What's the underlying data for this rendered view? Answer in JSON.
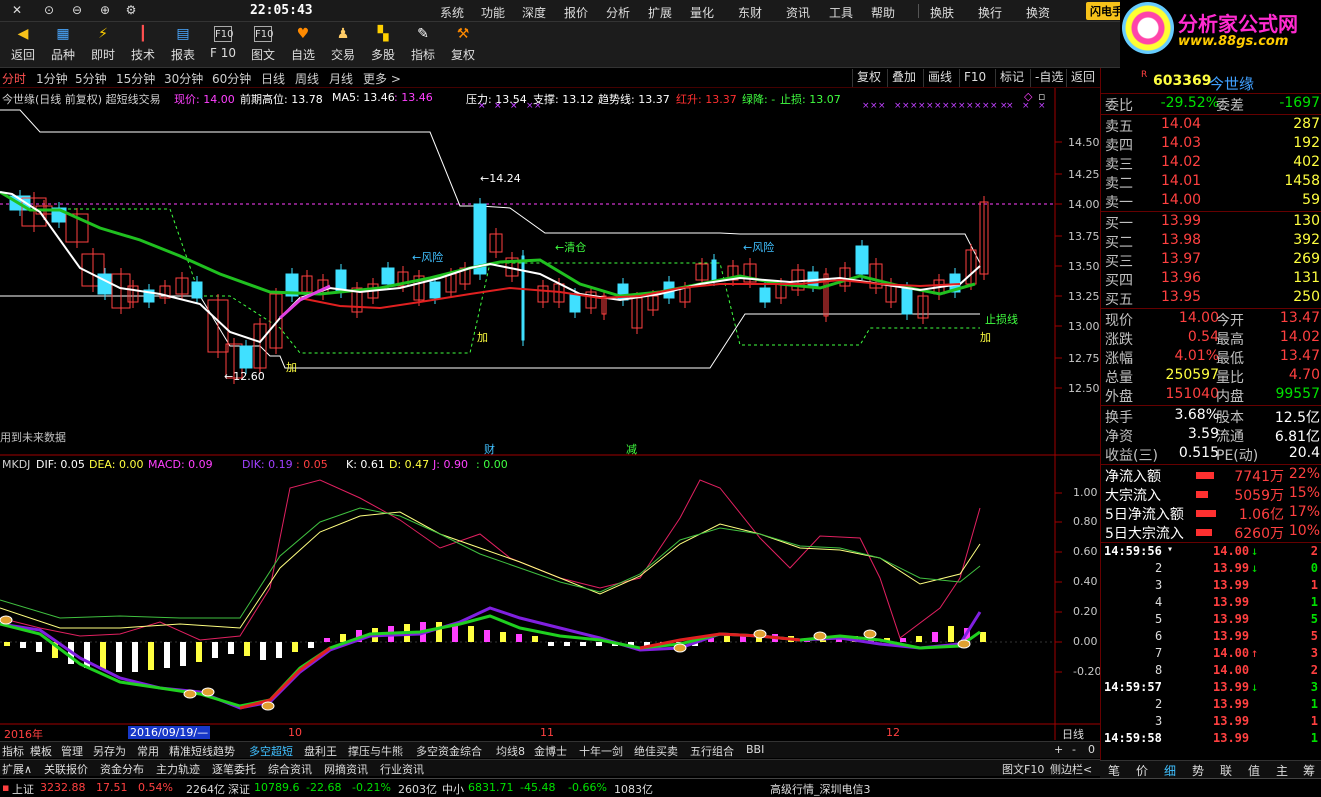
{
  "menubar": {
    "clock": "22:05:43",
    "items": [
      "系统",
      "功能",
      "深度",
      "报价",
      "分析",
      "扩展",
      "量化",
      "东财",
      "资讯",
      "工具",
      "帮助"
    ],
    "right_items": [
      "换肤",
      "换行",
      "换资"
    ],
    "flash_label": "闪电手",
    "logo_title": "分析家公式网",
    "logo_url": "www.88gs.com"
  },
  "toolbar": [
    {
      "label": "返回",
      "icon": "back-arrow-icon",
      "color": "#f7c21a"
    },
    {
      "label": "品种",
      "icon": "variety-icon",
      "color": "#4aa8ff"
    },
    {
      "label": "即时",
      "icon": "lightning-icon",
      "color": "#ffd000"
    },
    {
      "label": "技术",
      "icon": "candlestick-icon",
      "color": "#ff5050"
    },
    {
      "label": "报表",
      "icon": "report-icon",
      "color": "#4aa8ff"
    },
    {
      "label": "F 10",
      "icon": "f10-icon",
      "color": "#ddd"
    },
    {
      "label": "图文",
      "icon": "f10-doc-icon",
      "color": "#ddd"
    },
    {
      "label": "自选",
      "icon": "favorite-icon",
      "color": "#ff8a00"
    },
    {
      "label": "交易",
      "icon": "trade-person-icon",
      "color": "#ffcc66"
    },
    {
      "label": "多股",
      "icon": "multi-stock-icon",
      "color": "#ffd000"
    },
    {
      "label": "指标",
      "icon": "indicator-icon",
      "color": "#ffffff"
    },
    {
      "label": "复权",
      "icon": "hammer-icon",
      "color": "#ff8a00"
    }
  ],
  "periods": [
    "分时",
    "1分钟",
    "5分钟",
    "15分钟",
    "30分钟",
    "60分钟",
    "日线",
    "周线",
    "月线",
    "更多 >"
  ],
  "active_period": "分时",
  "chart_buttons": [
    "复权",
    "叠加",
    "画线",
    "F10",
    "标记",
    "-自选",
    "返回"
  ],
  "main_indicator": {
    "name": "今世缘(日线 前复权) 超短线交易",
    "price_label": "现价: 14.00",
    "prev_high": "前期高位: 13.78",
    "ma5": "MA5: 13.46",
    "ma5b": ": 13.46",
    "pressure": "压力: 13.54",
    "support": "支撑: 13.12",
    "trend": "趋势线: 13.37",
    "rise": "红升: 13.37",
    "fall": "绿降: -",
    "stop": "止损: 13.07"
  },
  "chart_annotations": {
    "high_label": "14.24",
    "low_label": "12.60",
    "risk1": "←风险",
    "clear": "←清仓",
    "risk2": "←风险",
    "stop_line": "止损线",
    "add1": "加",
    "add2": "加",
    "add3": "加",
    "future_note": "用到未来数据",
    "cai": "财",
    "jian": "减"
  },
  "price_axis": [
    "14.50",
    "14.25",
    "14.00",
    "13.75",
    "13.50",
    "13.25",
    "13.00",
    "12.75",
    "12.50"
  ],
  "macd_indicator": {
    "name": "MKDJ",
    "dif": "DIF: 0.05",
    "dea": "DEA: 0.00",
    "macd": "MACD: 0.09",
    "dik": "DIK: 0.19",
    "dik2": ": 0.05",
    "k": "K: 0.61",
    "d": "D: 0.47",
    "j": "J: 0.90",
    "j2": ": 0.00"
  },
  "macd_axis": [
    "1.00",
    "0.80",
    "0.60",
    "0.40",
    "0.20",
    "0.00",
    "-0.20"
  ],
  "date_axis": {
    "year": "2016年",
    "cursor_date": "2016/09/19/—",
    "m10": "10",
    "m11": "11",
    "m12": "12",
    "period": "日线"
  },
  "tabs_row1": [
    "指标",
    "模板",
    "管理",
    "另存为",
    "常用",
    "精准短线趋势",
    "多空超短",
    "盘利王",
    "撑压与牛熊",
    "多空资金综合",
    "均线8",
    "金博士",
    "十年一剑",
    "绝佳买卖",
    "五行组合",
    "BBI"
  ],
  "tabs_row1_active": "多空超短",
  "tabs_row2": [
    "扩展∧",
    "关联报价",
    "资金分布",
    "主力轨迹",
    "逐笔委托",
    "综合资讯",
    "网摘资讯",
    "行业资讯"
  ],
  "tabs_row2_right": [
    "图文F10",
    "侧边栏<"
  ],
  "stock": {
    "code": "603369",
    "name": "今世缘",
    "badge": "R"
  },
  "order_ratio": {
    "wb_label": "委比",
    "wb": "-29.52%",
    "wc_label": "委差",
    "wc": "-1697"
  },
  "asks": [
    {
      "label": "卖五",
      "price": "14.04",
      "vol": "287"
    },
    {
      "label": "卖四",
      "price": "14.03",
      "vol": "192"
    },
    {
      "label": "卖三",
      "price": "14.02",
      "vol": "402"
    },
    {
      "label": "卖二",
      "price": "14.01",
      "vol": "1458"
    },
    {
      "label": "卖一",
      "price": "14.00",
      "vol": "59"
    }
  ],
  "bids": [
    {
      "label": "买一",
      "price": "13.99",
      "vol": "130"
    },
    {
      "label": "买二",
      "price": "13.98",
      "vol": "392"
    },
    {
      "label": "买三",
      "price": "13.97",
      "vol": "269"
    },
    {
      "label": "买四",
      "price": "13.96",
      "vol": "131"
    },
    {
      "label": "买五",
      "price": "13.95",
      "vol": "250"
    }
  ],
  "quote": [
    {
      "k": "现价",
      "v": "14.00",
      "vc": "red",
      "k2": "今开",
      "v2": "13.47",
      "v2c": "red"
    },
    {
      "k": "涨跌",
      "v": "0.54",
      "vc": "red",
      "k2": "最高",
      "v2": "14.02",
      "v2c": "red"
    },
    {
      "k": "涨幅",
      "v": "4.01%",
      "vc": "red",
      "k2": "最低",
      "v2": "13.47",
      "v2c": "red"
    },
    {
      "k": "总量",
      "v": "250597",
      "vc": "yel",
      "k2": "量比",
      "v2": "4.70",
      "v2c": "red"
    },
    {
      "k": "外盘",
      "v": "151040",
      "vc": "red",
      "k2": "内盘",
      "v2": "99557",
      "v2c": "grn"
    }
  ],
  "finance": [
    {
      "k": "换手",
      "v": "3.68%",
      "k2": "股本",
      "v2": "12.5亿"
    },
    {
      "k": "净资",
      "v": "3.59",
      "k2": "流通",
      "v2": "6.81亿"
    },
    {
      "k": "收益(三)",
      "v": "0.515",
      "k2": "PE(动)",
      "v2": "20.4"
    }
  ],
  "flows": [
    {
      "k": "净流入额",
      "v": "7741万",
      "p": "22%"
    },
    {
      "k": "大宗流入",
      "v": "5059万",
      "p": "15%"
    },
    {
      "k": "5日净流入额",
      "v": "1.06亿",
      "p": "17%"
    },
    {
      "k": "5日大宗流入",
      "v": "6260万",
      "p": "10%"
    }
  ],
  "ticks": [
    {
      "t": "14:59:56",
      "n": "",
      "p": "14.00",
      "pc": "red",
      "a": "↓",
      "q": "2",
      "qc": "red",
      "mark": "▾"
    },
    {
      "t": "",
      "n": "2",
      "p": "13.99",
      "pc": "red",
      "a": "↓",
      "q": "0",
      "qc": "grn"
    },
    {
      "t": "",
      "n": "3",
      "p": "13.99",
      "pc": "red",
      "a": "",
      "q": "1",
      "qc": "red"
    },
    {
      "t": "",
      "n": "4",
      "p": "13.99",
      "pc": "red",
      "a": "",
      "q": "1",
      "qc": "grn"
    },
    {
      "t": "",
      "n": "5",
      "p": "13.99",
      "pc": "red",
      "a": "",
      "q": "5",
      "qc": "grn"
    },
    {
      "t": "",
      "n": "6",
      "p": "13.99",
      "pc": "red",
      "a": "",
      "q": "5",
      "qc": "red"
    },
    {
      "t": "",
      "n": "7",
      "p": "14.00",
      "pc": "red",
      "a": "↑",
      "q": "3",
      "qc": "red"
    },
    {
      "t": "",
      "n": "8",
      "p": "14.00",
      "pc": "red",
      "a": "",
      "q": "2",
      "qc": "red"
    },
    {
      "t": "14:59:57",
      "n": "",
      "p": "13.99",
      "pc": "red",
      "a": "↓",
      "q": "3",
      "qc": "grn"
    },
    {
      "t": "",
      "n": "2",
      "p": "13.99",
      "pc": "red",
      "a": "",
      "q": "1",
      "qc": "grn"
    },
    {
      "t": "",
      "n": "3",
      "p": "13.99",
      "pc": "red",
      "a": "",
      "q": "1",
      "qc": "red"
    },
    {
      "t": "14:59:58",
      "n": "",
      "p": "13.99",
      "pc": "red",
      "a": "",
      "q": "1",
      "qc": "grn"
    }
  ],
  "rbottom": [
    "笔",
    "价",
    "细",
    "势",
    "联",
    "值",
    "主",
    "筹"
  ],
  "status": {
    "sh_label": "上证",
    "sh_val": "3232.88",
    "sh_chg": "17.51",
    "sh_pct": "0.54%",
    "sh_amt": "2264亿",
    "sz_label": "深证",
    "sz_val": "10789.6",
    "sz_chg": "-22.68",
    "sz_pct": "-0.21%",
    "sz_amt": "2603亿",
    "zx_label": "中小",
    "zx_val": "6831.71",
    "zx_chg": "-45.48",
    "zx_pct": "-0.66%",
    "zx_amt": "1083亿",
    "feed": "高级行情_深圳电信3"
  }
}
